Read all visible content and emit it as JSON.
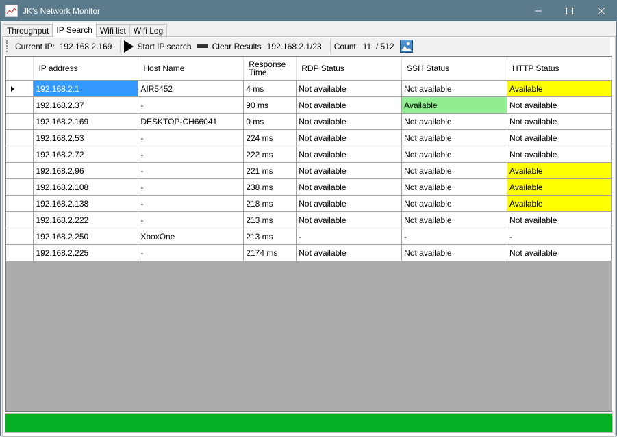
{
  "window": {
    "title": "JK's Network Monitor",
    "controls": [
      "minimize",
      "maximize",
      "close"
    ]
  },
  "tabs": [
    {
      "label": "Throughput",
      "active": false
    },
    {
      "label": "IP Search",
      "active": true
    },
    {
      "label": "Wifi list",
      "active": false
    },
    {
      "label": "Wifi Log",
      "active": false
    }
  ],
  "toolbar": {
    "current_ip_label": "Current IP:",
    "current_ip_value": "192.168.2.169",
    "start_label": "Start IP search",
    "clear_label": "Clear Results",
    "subnet": "192.168.2.1/23",
    "count_label": "Count:",
    "count_value": "11",
    "count_total": "/ 512"
  },
  "colors": {
    "titlebar": "#5b7a8c",
    "selected_cell": "#3399ff",
    "available_http": "#ffff00",
    "available_ssh": "#90ee90",
    "progress": "#06b025"
  },
  "table": {
    "headers": [
      "IP address",
      "Host Name",
      "Response Time",
      "RDP Status",
      "SSH Status",
      "HTTP Status"
    ],
    "rows": [
      {
        "ip": "192.168.2.1",
        "host": "AIR5452",
        "time": "4 ms",
        "rdp": "Not available",
        "ssh": "Not available",
        "http": "Available"
      },
      {
        "ip": "192.168.2.37",
        "host": "-",
        "time": "90 ms",
        "rdp": "Not available",
        "ssh": "Available",
        "http": "Not available"
      },
      {
        "ip": "192.168.2.169",
        "host": "DESKTOP-CH66041",
        "time": "0 ms",
        "rdp": "Not available",
        "ssh": "Not available",
        "http": "Not available"
      },
      {
        "ip": "192.168.2.53",
        "host": "-",
        "time": "224 ms",
        "rdp": "Not available",
        "ssh": "Not available",
        "http": "Not available"
      },
      {
        "ip": "192.168.2.72",
        "host": "-",
        "time": "222 ms",
        "rdp": "Not available",
        "ssh": "Not available",
        "http": "Not available"
      },
      {
        "ip": "192.168.2.96",
        "host": "-",
        "time": "221 ms",
        "rdp": "Not available",
        "ssh": "Not available",
        "http": "Available"
      },
      {
        "ip": "192.168.2.108",
        "host": "-",
        "time": "238 ms",
        "rdp": "Not available",
        "ssh": "Not available",
        "http": "Available"
      },
      {
        "ip": "192.168.2.138",
        "host": "-",
        "time": "218 ms",
        "rdp": "Not available",
        "ssh": "Not available",
        "http": "Available"
      },
      {
        "ip": "192.168.2.222",
        "host": "-",
        "time": "213 ms",
        "rdp": "Not available",
        "ssh": "Not available",
        "http": "Not available"
      },
      {
        "ip": "192.168.2.250",
        "host": "XboxOne",
        "time": "213 ms",
        "rdp": "-",
        "ssh": "-",
        "http": "-"
      },
      {
        "ip": "192.168.2.225",
        "host": "-",
        "time": "2174 ms",
        "rdp": "Not available",
        "ssh": "Not available",
        "http": "Not available"
      }
    ]
  },
  "progress": {
    "fraction": 1.0
  }
}
